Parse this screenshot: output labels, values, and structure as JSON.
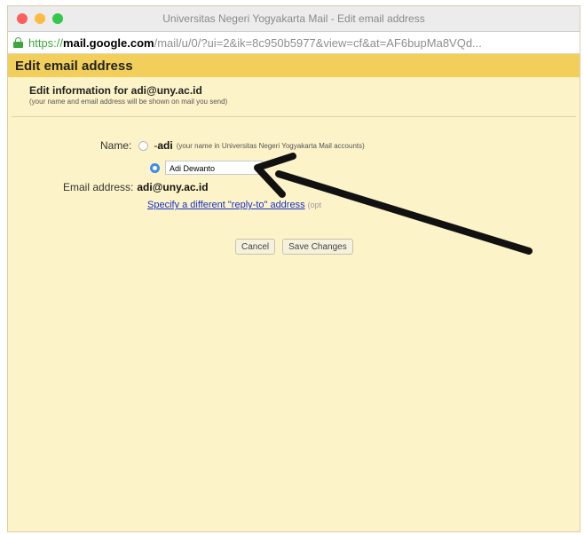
{
  "window": {
    "title": "Universitas Negeri Yogyakarta Mail - Edit email address"
  },
  "url": {
    "scheme": "https://",
    "host": "mail.google.com",
    "rest": "/mail/u/0/?ui=2&ik=8c950b5977&view=cf&at=AF6bupMa8VQd..."
  },
  "header": {
    "title": "Edit email address"
  },
  "info": {
    "title": "Edit information for adi@uny.ac.id",
    "subtitle": "(your name and email address will be shown on mail you send)"
  },
  "form": {
    "name_label": "Name:",
    "option1_prefix": "- ",
    "option1_name": "adi",
    "option1_hint": "(your name in Universitas Negeri Yogyakarta Mail accounts)",
    "option2_value": "Adi Dewanto",
    "email_label": "Email address:",
    "email_value": "adi@uny.ac.id",
    "reply_link": "Specify a different \"reply-to\" address",
    "reply_suffix": "(opt"
  },
  "buttons": {
    "cancel": "Cancel",
    "save": "Save Changes"
  },
  "colors": {
    "header": "#f2cf5b",
    "background": "#fdf3c8",
    "link": "#1a33c8",
    "radio_checked": "#3d8ee9"
  }
}
